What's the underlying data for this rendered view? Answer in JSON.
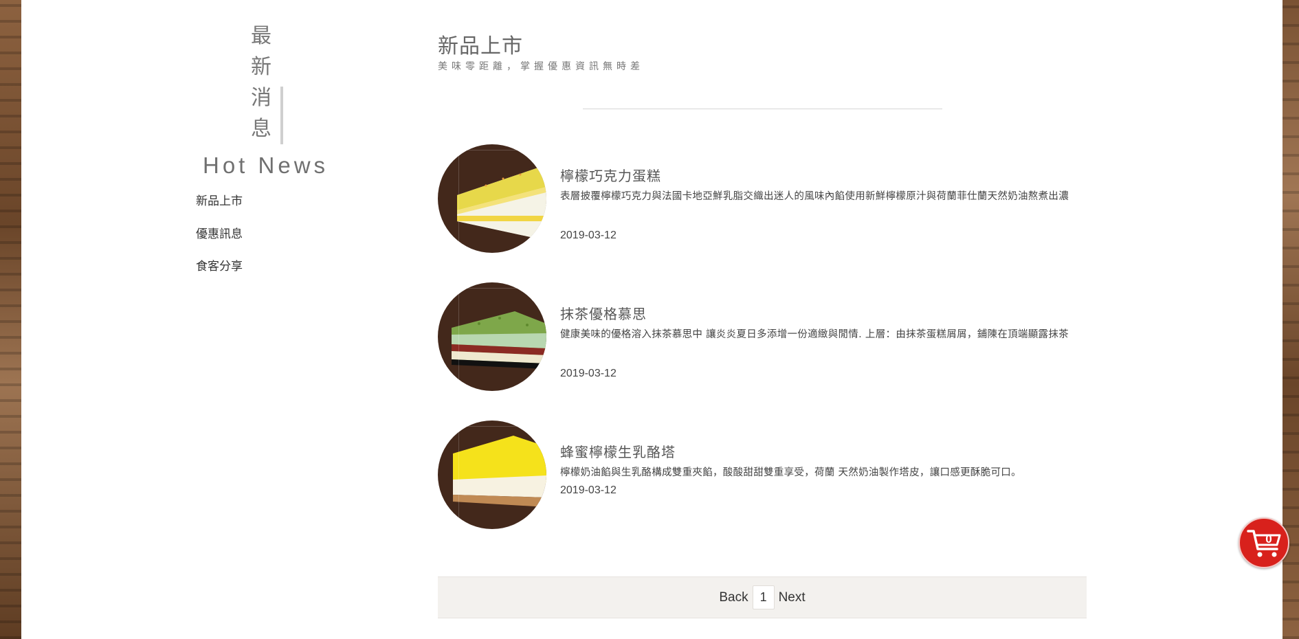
{
  "sidebar": {
    "vertical_title": [
      "最",
      "新",
      "消",
      "息"
    ],
    "subtitle": "Hot News",
    "menu": [
      {
        "label": "新品上市"
      },
      {
        "label": "優惠訊息"
      },
      {
        "label": "食客分享"
      }
    ]
  },
  "header": {
    "title": "新品上市",
    "subtitle": "美味零距離，掌握優惠資訊無時差"
  },
  "news": [
    {
      "title": "檸檬巧克力蛋糕",
      "description": "表層披覆檸檬巧克力與法國卡地亞鮮乳脂交織出迷人的風味內餡使用新鮮檸檬原汁與荷蘭菲仕蘭天然奶油熬煮出濃",
      "date": "2019-03-12",
      "image": "lemon-chocolate-cake-slice"
    },
    {
      "title": "抹茶優格慕思",
      "description": "健康美味的優格溶入抹茶慕思中 讓炎炎夏日多添增一份適緻與閒情. 上層：由抹茶蛋糕屑屑，鋪陳在頂端顯露抹茶",
      "date": "2019-03-12",
      "image": "matcha-yogurt-mousse-slice"
    },
    {
      "title": "蜂蜜檸檬生乳酪塔",
      "description": "檸檬奶油餡與生乳酪構成雙重夾餡，酸酸甜甜雙重享受，荷蘭 天然奶油製作塔皮，讓口感更酥脆可口。",
      "date": "2019-03-12",
      "image": "honey-lemon-cheese-tart-slice"
    }
  ],
  "pagination": {
    "back_label": "Back",
    "current_page": "1",
    "next_label": "Next"
  },
  "cart": {
    "count": "0",
    "icon": "shopping-cart-icon",
    "color": "#d8211c"
  }
}
